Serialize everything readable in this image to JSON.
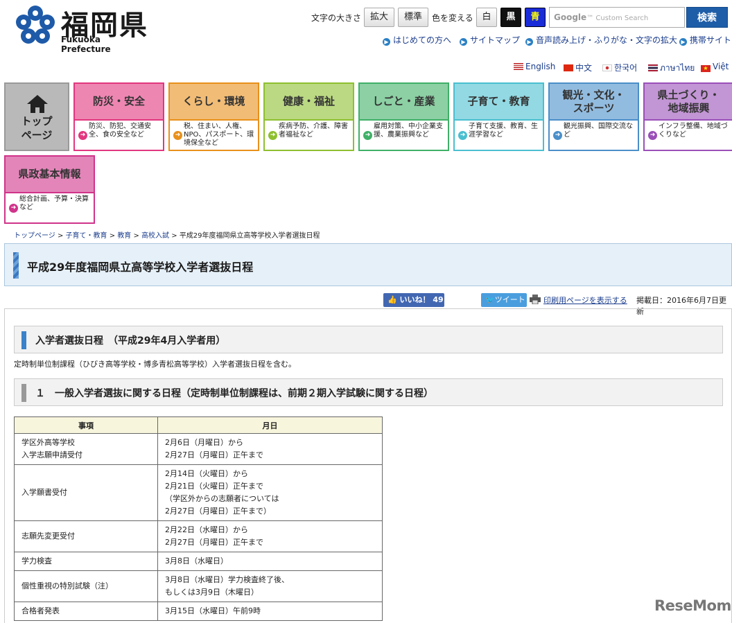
{
  "header": {
    "logo_title": "福岡県",
    "logo_sub": "Fukuoka Prefecture",
    "font_size_label": "文字の大きさ",
    "enlarge_btn": "拡大",
    "standard_btn": "標準",
    "color_label": "色を変える",
    "white_btn": "白",
    "black_btn": "黒",
    "blue_btn": "青",
    "search_placeholder": "Custom Search",
    "search_btn": "検索",
    "links": [
      "はじめての方へ",
      "サイトマップ",
      "音声読み上げ・ふりがな・文字の拡大",
      "携帯サイト"
    ],
    "languages": [
      "English",
      "中文",
      "한국어",
      "ภาษาไทย",
      "Việt"
    ]
  },
  "nav": {
    "top_label": "トップ\nページ",
    "tiles": [
      {
        "title": "防災・安全",
        "desc": "防災、防犯、交通安全、食の安全など",
        "color": "#e2367f"
      },
      {
        "title": "くらし・環境",
        "desc": "税、住まい、人権、NPO、パスポート、環境保全など",
        "color": "#e8901a"
      },
      {
        "title": "健康・福祉",
        "desc": "疾病予防、介護、障害者福祉など",
        "color": "#8ebf2f"
      },
      {
        "title": "しごと・産業",
        "desc": "雇用対策、中小企業支援、農業振興など",
        "color": "#3fb068"
      },
      {
        "title": "子育て・教育",
        "desc": "子育て支援、教育、生涯学習など",
        "color": "#49bfd0"
      },
      {
        "title": "観光・文化・\nスポーツ",
        "desc": "観光振興、国際交流など",
        "color": "#4a8fc9"
      },
      {
        "title": "県土づくり・\n地域振興",
        "desc": "インフラ整備、地域づくりなど",
        "color": "#9a4fb8"
      },
      {
        "title": "県政基本情報",
        "desc": "総合計画、予算・決算など",
        "color": "#d0338a"
      }
    ]
  },
  "breadcrumb": {
    "items": [
      "トップページ",
      "子育て・教育",
      "教育",
      "高校入試"
    ],
    "current": "平成29年度福岡県立高等学校入学者選抜日程"
  },
  "page_title": "平成29年度福岡県立高等学校入学者選抜日程",
  "social": {
    "like": "いいね！ 49",
    "tweet": "ツイート",
    "print": "印刷用ページを表示する",
    "pubdate": "掲載日：2016年6月7日更新"
  },
  "section1_title": "入学者選抜日程　（平成29年4月入学者用）",
  "note": "定時制単位制課程（ひびき高等学校・博多青松高等学校）入学者選抜日程を含む。",
  "section2_title": "１　一般入学者選抜に関する日程（定時制単位制課程は、前期２期入学試験に関する日程）",
  "table": {
    "headers": [
      "事項",
      "月日"
    ],
    "rows": [
      {
        "item": "学区外高等学校\n入学志願申請受付",
        "date": "2月6日（月曜日）から\n2月27日（月曜日）正午まで"
      },
      {
        "item": "入学願書受付",
        "date": "2月14日（火曜日）から\n2月21日（火曜日）正午まで\n（学区外からの志願者については\n2月27日（月曜日）正午まで）"
      },
      {
        "item": "志願先変更受付",
        "date": "2月22日（水曜日）から\n2月27日（月曜日）正午まで"
      },
      {
        "item": "学力検査",
        "date": "3月8日（水曜日）"
      },
      {
        "item": "個性重視の特別試験（注）",
        "date": "3月8日（水曜日）学力検査終了後、\nもしくは3月9日（木曜日）"
      },
      {
        "item": "合格者発表",
        "date": "3月15日（水曜日）午前9時"
      }
    ]
  },
  "watermark": "ReseMom"
}
